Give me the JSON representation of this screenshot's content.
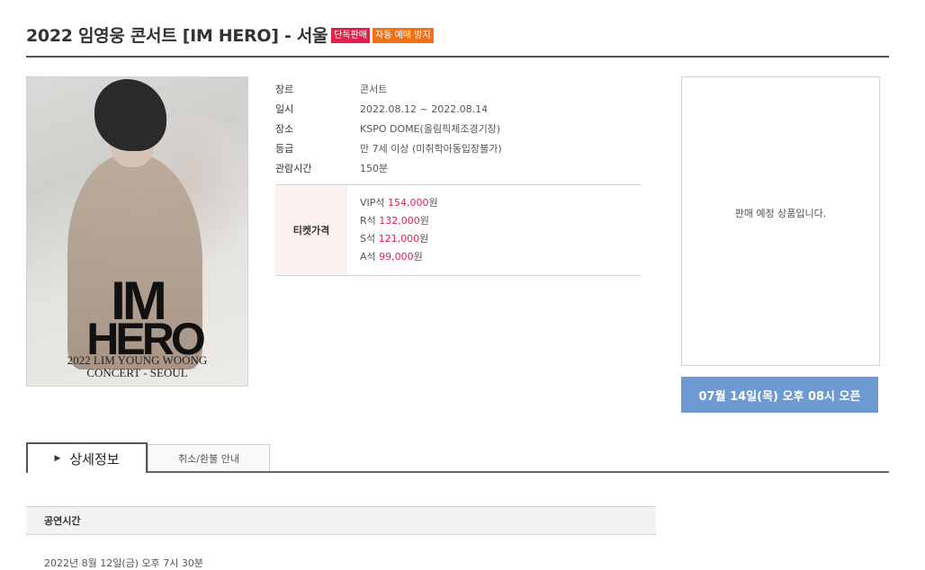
{
  "header": {
    "title": "2022 임영웅 콘서트 [IM HERO] - 서울",
    "badge_exclusive": "단독판매",
    "badge_antibot": "자동 예매 방지"
  },
  "poster": {
    "title_line1": "IM",
    "title_line2": "HERO",
    "subtitle_line1": "2022 LIM YOUNG WOONG",
    "subtitle_line2": "CONCERT - SEOUL"
  },
  "info": {
    "rows": [
      {
        "label": "장르",
        "value": "콘서트"
      },
      {
        "label": "일시",
        "value": "2022.08.12 ~ 2022.08.14"
      },
      {
        "label": "장소",
        "value": "KSPO DOME(올림픽체조경기장)"
      },
      {
        "label": "등급",
        "value": "만 7세 이상 (미취학아동입장불가)"
      },
      {
        "label": "관람시간",
        "value": "150분"
      }
    ]
  },
  "prices": {
    "heading": "티켓가격",
    "items": [
      {
        "grade": "VIP석",
        "amount": "154,000",
        "unit": "원"
      },
      {
        "grade": "R석",
        "amount": "132,000",
        "unit": "원"
      },
      {
        "grade": "S석",
        "amount": "121,000",
        "unit": "원"
      },
      {
        "grade": "A석",
        "amount": "99,000",
        "unit": "원"
      }
    ]
  },
  "sidebar": {
    "notice": "판매 예정 상품입니다.",
    "open_button": "07월 14일(목) 오후 08시 오픈"
  },
  "tabs": {
    "detail": "상세정보",
    "refund": "취소/환불 안내"
  },
  "detail": {
    "section_title": "공연시간",
    "section_text": "2022년 8월 12일(금) 오후 7시 30분"
  },
  "colors": {
    "badge_red": "#e6204d",
    "badge_orange": "#f27117",
    "price_red": "#e6204d",
    "open_button_blue": "#6b9bd1"
  }
}
